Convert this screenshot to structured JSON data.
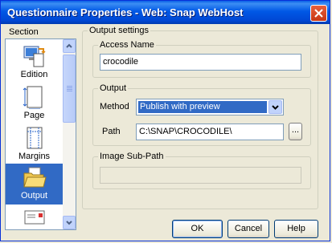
{
  "window": {
    "title": "Questionnaire Properties - Web: Snap WebHost"
  },
  "section": {
    "label": "Section",
    "items": [
      {
        "label": "Edition",
        "icon": "edition-icon",
        "selected": false
      },
      {
        "label": "Page",
        "icon": "page-icon",
        "selected": false
      },
      {
        "label": "Margins",
        "icon": "margins-icon",
        "selected": false
      },
      {
        "label": "Output",
        "icon": "folder-icon",
        "selected": true
      },
      {
        "label": "",
        "icon": "envelope-icon",
        "selected": false
      }
    ]
  },
  "output_settings": {
    "label": "Output settings",
    "access_name": {
      "label": "Access Name",
      "value": "crocodile"
    },
    "output": {
      "label": "Output",
      "method_label": "Method",
      "method_value": "Publish with preview",
      "path_label": "Path",
      "path_value": "C:\\SNAP\\CROCODILE\\",
      "browse_label": "..."
    },
    "image_sub_path": {
      "label": "Image Sub-Path",
      "value": ""
    }
  },
  "buttons": {
    "ok": "OK",
    "cancel": "Cancel",
    "help": "Help"
  },
  "colors": {
    "titlebar": "#0058e6",
    "selection": "#316ac5",
    "dialog_bg": "#ece9d8"
  }
}
